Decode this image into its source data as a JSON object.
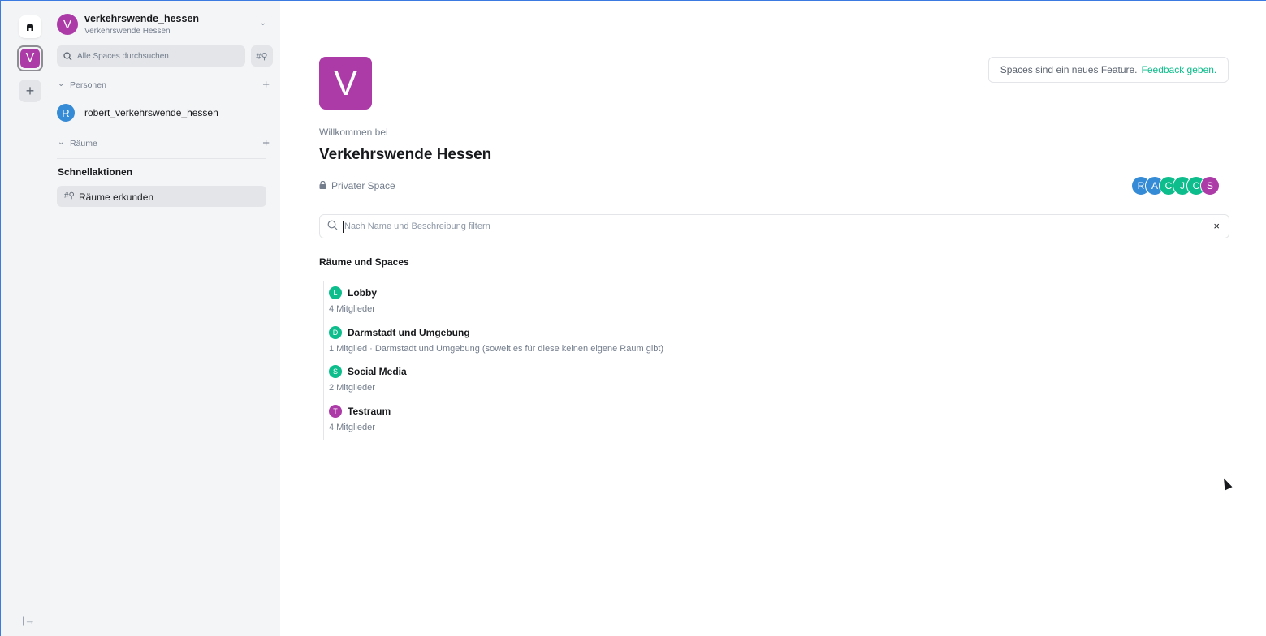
{
  "rail": {
    "home_icon": "home-icon",
    "space_initial": "V",
    "add_label": "+",
    "collapse_label": "|→"
  },
  "panel": {
    "space_initial": "V",
    "space_name": "verkehrswende_hessen",
    "space_subtitle": "Verkehrswende Hessen",
    "chevron": "⌄",
    "search_placeholder": "Alle Spaces durchsuchen",
    "explore_icon": "#⚲",
    "people_section": "Personen",
    "rooms_section": "Räume",
    "person": {
      "initial": "R",
      "name": "robert_verkehrswende_hessen"
    },
    "quick_actions_title": "Schnellaktionen",
    "quick_actions": [
      {
        "icon": "#⚲",
        "label": "Räume erkunden"
      }
    ]
  },
  "main": {
    "avatar_initial": "V",
    "feedback_text": "Spaces sind ein neues Feature.",
    "feedback_link": "Feedback geben.",
    "welcome": "Willkommen bei",
    "title": "Verkehrswende Hessen",
    "privacy": "Privater Space",
    "member_faces": [
      {
        "initial": "R",
        "color": "#368bd6"
      },
      {
        "initial": "A",
        "color": "#368bd6"
      },
      {
        "initial": "C",
        "color": "#0dbd8b"
      },
      {
        "initial": "J",
        "color": "#0dbd8b"
      },
      {
        "initial": "C",
        "color": "#0dbd8b"
      },
      {
        "initial": "S",
        "color": "#ac3ba8"
      }
    ],
    "filter_placeholder": "Nach Name und Beschreibung filtern",
    "clear_icon": "×",
    "rooms_title": "Räume und Spaces",
    "rooms": [
      {
        "initial": "L",
        "color": "#0dbd8b",
        "name": "Lobby",
        "meta": "4 Mitglieder"
      },
      {
        "initial": "D",
        "color": "#0dbd8b",
        "name": "Darmstadt und Umgebung",
        "meta": "1 Mitglied · Darmstadt und Umgebung (soweit es für diese keinen eigene Raum gibt)"
      },
      {
        "initial": "S",
        "color": "#0dbd8b",
        "name": "Social Media",
        "meta": "2 Mitglieder"
      },
      {
        "initial": "T",
        "color": "#ac3ba8",
        "name": "Testraum",
        "meta": "4 Mitglieder"
      }
    ]
  }
}
